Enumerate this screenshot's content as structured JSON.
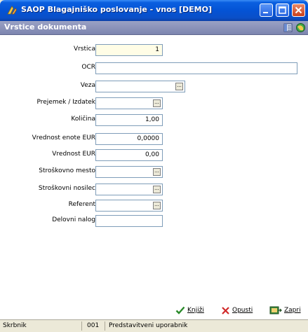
{
  "window": {
    "title": "SAOP Blagajniško poslovanje  -  vnos [DEMO]"
  },
  "subheader": {
    "title": "Vrstice dokumenta"
  },
  "form": {
    "vrstica": {
      "label": "Vrstica",
      "value": "1"
    },
    "ocr": {
      "label": "OCR",
      "value": ""
    },
    "veza": {
      "label": "Veza",
      "value": ""
    },
    "prejemek": {
      "label": "Prejemek / Izdatek",
      "value": ""
    },
    "kolicina": {
      "label": "Količina",
      "value": "1,00"
    },
    "vrednost_enote": {
      "label": "Vrednost enote EUR",
      "value": "0,0000"
    },
    "vrednost": {
      "label": "Vrednost EUR",
      "value": "0,00"
    },
    "stroskovno_mesto": {
      "label": "Stroškovno mesto",
      "value": ""
    },
    "stroskovni_nosilec": {
      "label": "Stroškovni nosilec",
      "value": ""
    },
    "referent": {
      "label": "Referent",
      "value": ""
    },
    "delovni_nalog": {
      "label": "Delovni nalog",
      "value": ""
    },
    "ellipsis": "..."
  },
  "footer": {
    "knjizi": {
      "label": "Knjiži",
      "icon": "checkmark-icon"
    },
    "opusti": {
      "label": "Opusti",
      "icon": "x-cancel-icon"
    },
    "zapri": {
      "label": "Zapri",
      "icon": "close-door-icon"
    }
  },
  "statusbar": {
    "user": "Skrbnik",
    "code": "001",
    "description": "Predstavitveni uporabnik"
  },
  "colors": {
    "title_blue": "#0453d5",
    "subheader": "#8a91b9",
    "window_bg": "#ece9d8"
  }
}
